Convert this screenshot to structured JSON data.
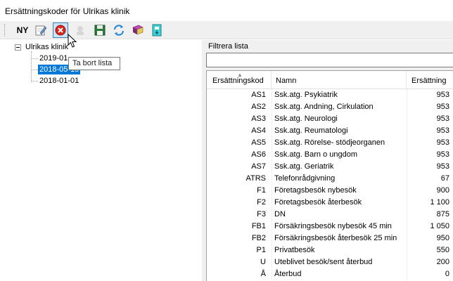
{
  "window": {
    "title": "Ersättningskoder för Ulrikas klinik"
  },
  "toolbar": {
    "new_label": "NY",
    "buttons": [
      {
        "icon": "edit-icon"
      },
      {
        "icon": "delete-icon",
        "pressed": true
      },
      {
        "icon": "copy-icon",
        "disabled": true
      },
      {
        "icon": "save-icon"
      },
      {
        "icon": "refresh-icon"
      },
      {
        "icon": "book-icon"
      },
      {
        "icon": "export-icon"
      }
    ]
  },
  "tooltip": {
    "text": "Ta bort lista"
  },
  "tree": {
    "root": "Ulrikas klinik",
    "children": [
      "2019-01",
      "2018-05-15",
      "2018-01-01"
    ],
    "selected_index": 1
  },
  "filter": {
    "label": "Filtrera lista",
    "value": ""
  },
  "grid": {
    "columns": [
      "Ersättningskod",
      "Namn",
      "Ersättning"
    ],
    "rows": [
      {
        "code": "AS1",
        "name": "Ssk.atg. Psykiatrik",
        "amount": "953"
      },
      {
        "code": "AS2",
        "name": "Ssk.atg. Andning, Cirkulation",
        "amount": "953"
      },
      {
        "code": "AS3",
        "name": "Ssk.atg. Neurologi",
        "amount": "953"
      },
      {
        "code": "AS4",
        "name": "Ssk.atg. Reumatologi",
        "amount": "953"
      },
      {
        "code": "AS5",
        "name": "Ssk.atg. Rörelse- stödjeorganen",
        "amount": "953"
      },
      {
        "code": "AS6",
        "name": "Ssk.atg. Barn o ungdom",
        "amount": "953"
      },
      {
        "code": "AS7",
        "name": "Ssk.atg. Geriatrik",
        "amount": "953"
      },
      {
        "code": "ATRS",
        "name": "Telefonrådgivning",
        "amount": "67"
      },
      {
        "code": "F1",
        "name": "Företagsbesök nybesök",
        "amount": "900"
      },
      {
        "code": "F2",
        "name": "Företagsbesök återbesök",
        "amount": "1 100"
      },
      {
        "code": "F3",
        "name": "DN",
        "amount": "875"
      },
      {
        "code": "FB1",
        "name": "Försäkringsbesök nybesök 45 min",
        "amount": "1 050"
      },
      {
        "code": "FB2",
        "name": "Försäkringsbesök återbesök 25 min",
        "amount": "950"
      },
      {
        "code": "P1",
        "name": "Privatbesök",
        "amount": "550"
      },
      {
        "code": "U",
        "name": "Uteblivet besök/sent återbud",
        "amount": "200"
      },
      {
        "code": "Å",
        "name": "Återbud",
        "amount": "0"
      }
    ]
  }
}
